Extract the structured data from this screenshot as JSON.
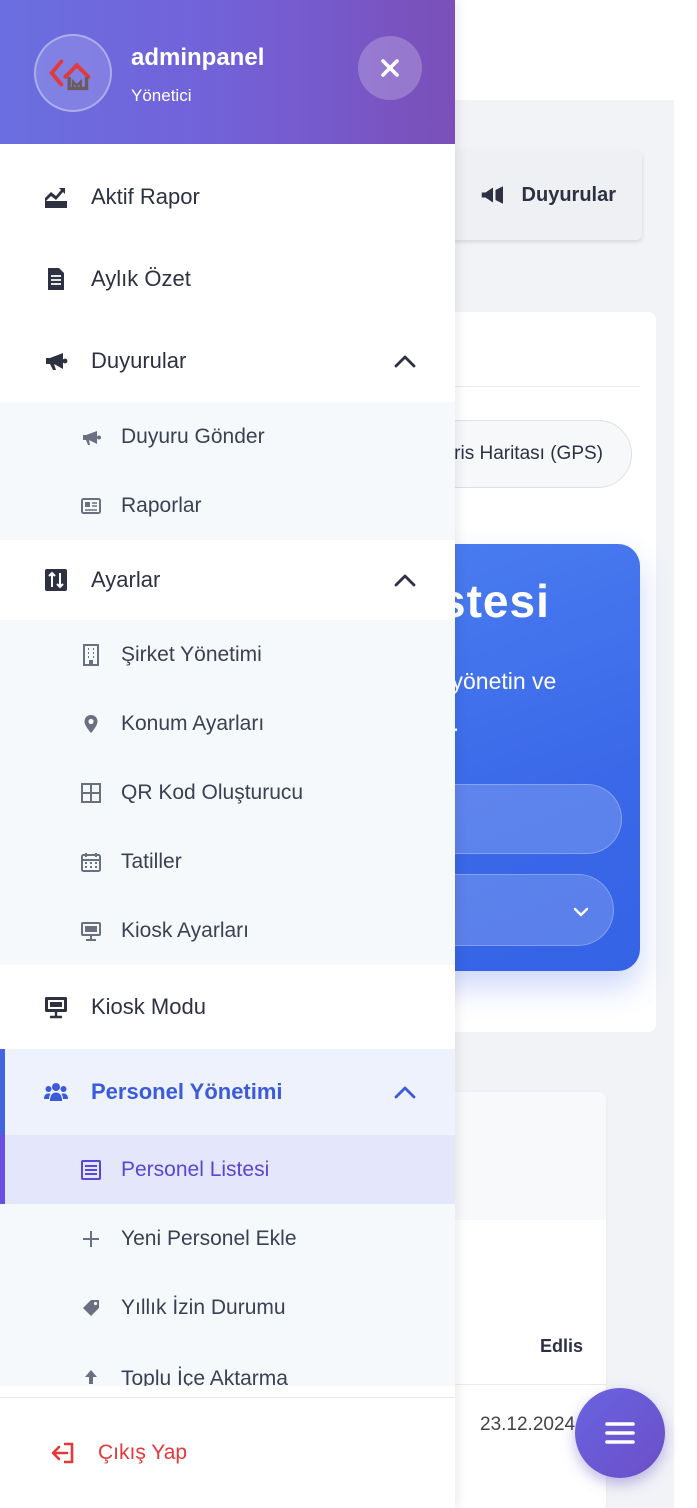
{
  "header": {
    "brand": "adminpanel",
    "role": "Yönetici"
  },
  "menu": {
    "aktif_rapor": "Aktif Rapor",
    "aylik_ozet": "Aylık Özet",
    "duyurular": {
      "label": "Duyurular",
      "children": [
        "Duyuru Gönder",
        "Raporlar"
      ]
    },
    "ayarlar": {
      "label": "Ayarlar",
      "children": [
        "Şirket Yönetimi",
        "Konum Ayarları",
        "QR Kod Oluşturucu",
        "Tatiller",
        "Kiosk Ayarları"
      ]
    },
    "kiosk_modu": "Kiosk Modu",
    "personel": {
      "label": "Personel Yönetimi",
      "children": [
        "Personel Listesi",
        "Yeni Personel Ekle",
        "Yıllık İzin Durumu",
        "Toplu İçe Aktarma"
      ]
    }
  },
  "footer": {
    "logout": "Çıkış Yap"
  },
  "background": {
    "announcements_button": "Duyurular",
    "gps_tab": "ris Haritası (GPS)",
    "hero_title": "stesi",
    "hero_line1": "i yönetin ve",
    "hero_line2": "n.",
    "table_header": "Edlis",
    "table_cell": "23.12.2024"
  },
  "colors": {
    "header_gradient_start": "#6a6fe0",
    "header_gradient_end": "#7b4fb8",
    "active_item": "#3b5bdb",
    "active_subitem": "#5a45d6",
    "logout": "#e5383b",
    "hero": "#3a68e8"
  }
}
